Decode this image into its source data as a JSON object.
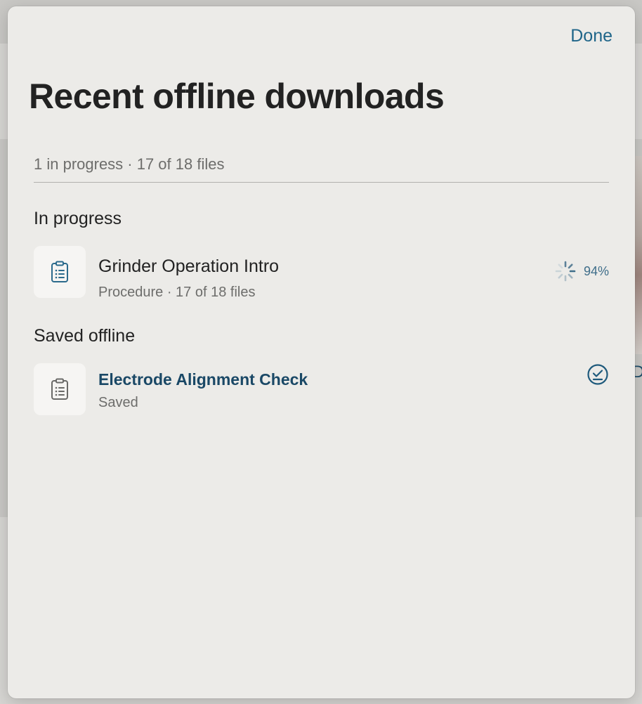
{
  "window": {
    "done_label": "Done",
    "title": "Recent offline downloads",
    "summary": "1 in progress · 17 of 18 files"
  },
  "sections": {
    "in_progress": {
      "heading": "In progress",
      "item": {
        "title": "Grinder Operation Intro",
        "subtitle": "Procedure · 17 of 18 files",
        "progress_label": "94%",
        "progress": 0.94,
        "icon": "clipboard-list-icon",
        "status_icon": "spinner-icon"
      }
    },
    "saved_offline": {
      "heading": "Saved offline",
      "item": {
        "title": "Electrode Alignment Check",
        "subtitle": "Saved",
        "icon": "clipboard-list-icon",
        "status_icon": "download-check-icon"
      }
    }
  },
  "colors": {
    "accent": "#1f6589",
    "link_title": "#1a4866",
    "sheet_bg": "#ecebe8",
    "thumb_bg": "#f6f5f3"
  }
}
